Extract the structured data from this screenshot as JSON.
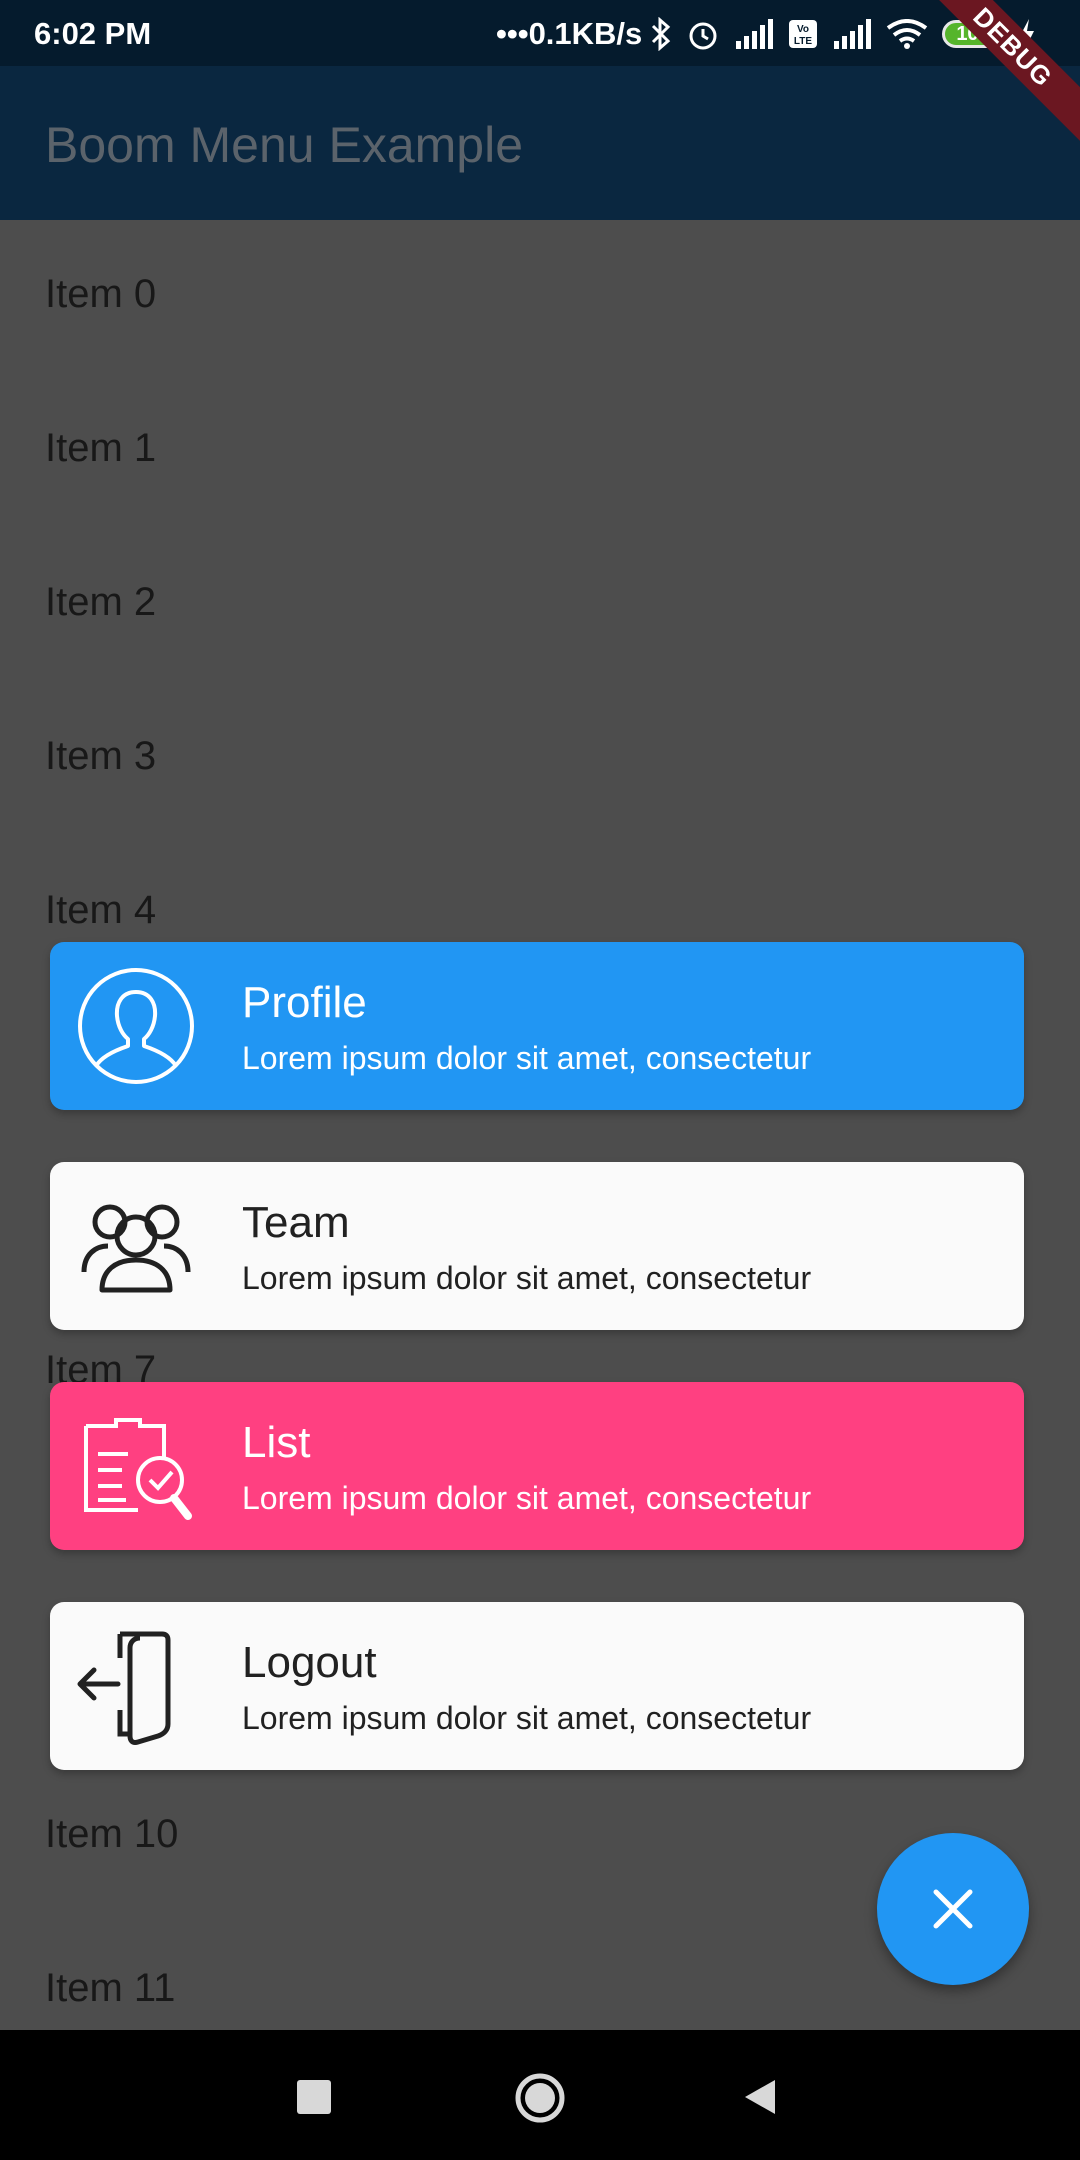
{
  "status": {
    "time": "6:02 PM",
    "speed": "0.1KB/s",
    "battery": "100"
  },
  "app_bar": {
    "title": "Boom Menu Example",
    "debug_label": "DEBUG"
  },
  "list": {
    "items": [
      {
        "label": "Item 0"
      },
      {
        "label": "Item 1"
      },
      {
        "label": "Item 2"
      },
      {
        "label": "Item 3"
      },
      {
        "label": "Item 4"
      },
      {
        "label": "Item 7"
      },
      {
        "label": "Item 10"
      },
      {
        "label": "Item 11"
      }
    ]
  },
  "menu": {
    "items": [
      {
        "title": "Profile",
        "subtitle": "Lorem ipsum dolor sit amet, consectetur",
        "icon": "profile-icon",
        "background": "#2196f3",
        "text_color": "#ffffff"
      },
      {
        "title": "Team",
        "subtitle": "Lorem ipsum dolor sit amet, consectetur",
        "icon": "team-icon",
        "background": "#fafafa",
        "text_color": "#212121"
      },
      {
        "title": "List",
        "subtitle": "Lorem ipsum dolor sit amet, consectetur",
        "icon": "list-icon",
        "background": "#ff4081",
        "text_color": "#ffffff"
      },
      {
        "title": "Logout",
        "subtitle": "Lorem ipsum dolor sit amet, consectetur",
        "icon": "logout-icon",
        "background": "#fafafa",
        "text_color": "#212121"
      }
    ]
  },
  "fab": {
    "icon": "close-icon",
    "background": "#2196f3"
  },
  "colors": {
    "accent": "#2196f3",
    "pink": "#ff4081",
    "app_bar": "#0a2740",
    "status_bar": "#051b2d"
  }
}
